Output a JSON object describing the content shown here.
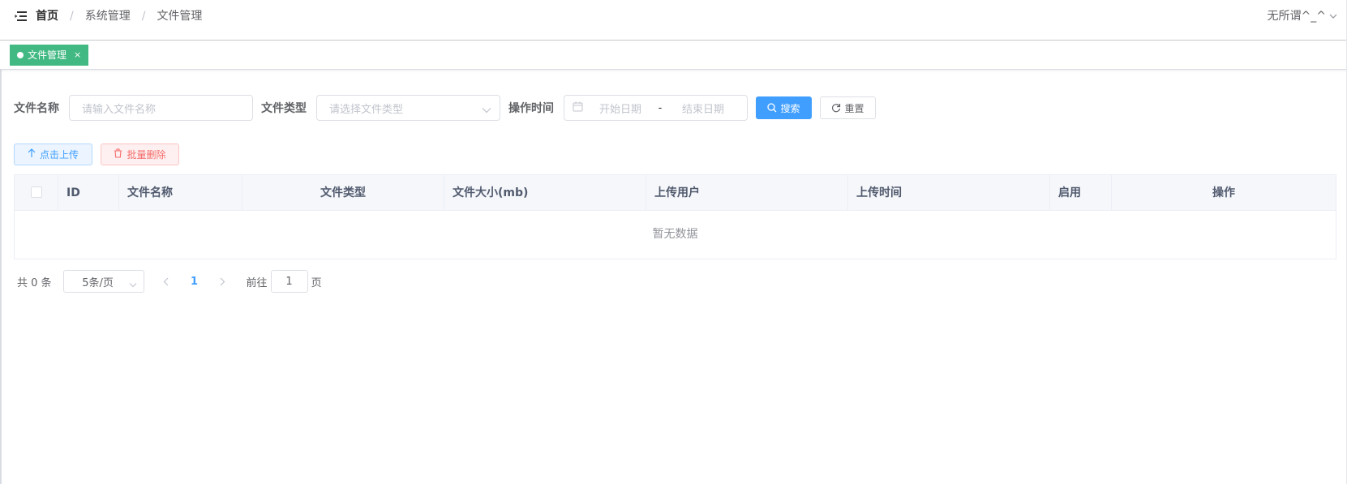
{
  "header": {
    "breadcrumb": [
      "首页",
      "系统管理",
      "文件管理"
    ],
    "separator": "/",
    "user_name": "无所谓^_^"
  },
  "tags": [
    {
      "label": "文件管理",
      "close": "×",
      "active": true
    }
  ],
  "search": {
    "name_label": "文件名称",
    "name_placeholder": "请输入文件名称",
    "type_label": "文件类型",
    "type_placeholder": "请选择文件类型",
    "time_label": "操作时间",
    "start_placeholder": "开始日期",
    "range_separator": "-",
    "end_placeholder": "结束日期",
    "search_button": "搜索",
    "reset_button": "重置"
  },
  "toolbar": {
    "upload_button": "点击上传",
    "batch_delete_button": "批量删除"
  },
  "table": {
    "columns": [
      "ID",
      "文件名称",
      "文件类型",
      "文件大小(mb)",
      "上传用户",
      "上传时间",
      "启用",
      "操作"
    ],
    "empty_text": "暂无数据"
  },
  "pagination": {
    "total_text": "共 0 条",
    "page_size": "5条/页",
    "current_page": "1",
    "goto_label": "前往",
    "goto_value": "1",
    "page_suffix": "页"
  },
  "colors": {
    "primary": "#409eff",
    "tag_active": "#42b983",
    "danger": "#f56c6c"
  }
}
